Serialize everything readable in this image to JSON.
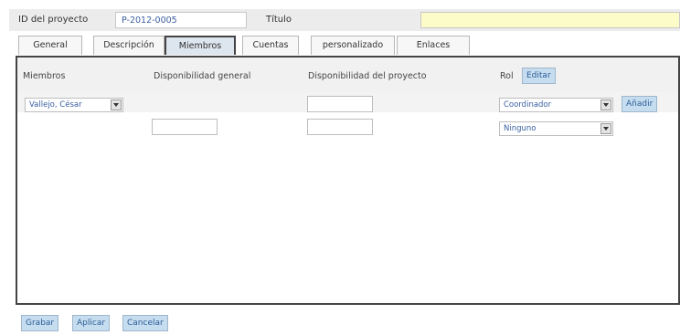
{
  "header": {
    "id_label": "ID del proyecto",
    "id_value": "P-2012-0005",
    "title_label": "Título"
  },
  "tabs": [
    {
      "label": "General",
      "active": false
    },
    {
      "label": "Descripción",
      "active": false
    },
    {
      "label": "Miembros",
      "active": true
    },
    {
      "label": "Cuentas",
      "active": false
    },
    {
      "label": "personalizado",
      "active": false
    },
    {
      "label": "Enlaces",
      "active": false
    }
  ],
  "members_table": {
    "columns": [
      "Miembros",
      "Disponibilidad general",
      "Disponibilidad del proyecto",
      "Rol"
    ],
    "edit_label": "Editar",
    "rows": [
      {
        "member": "Vallejo, César",
        "general_availability": "",
        "project_availability": "",
        "role": "Coordinador",
        "add_label": "Añadir"
      },
      {
        "member": "",
        "general_availability": "",
        "project_availability": "",
        "role": "Ninguno"
      }
    ]
  },
  "actions": {
    "save_label": "Grabar",
    "apply_label": "Aplicar",
    "cancel_label": "Cancelar"
  },
  "colors": {
    "header_bg": "#ececec",
    "title_field_bg": "#fcfcc8",
    "button_bg": "#c6dcef",
    "button_text": "#2d5f99",
    "active_tab_border": "#444444"
  }
}
